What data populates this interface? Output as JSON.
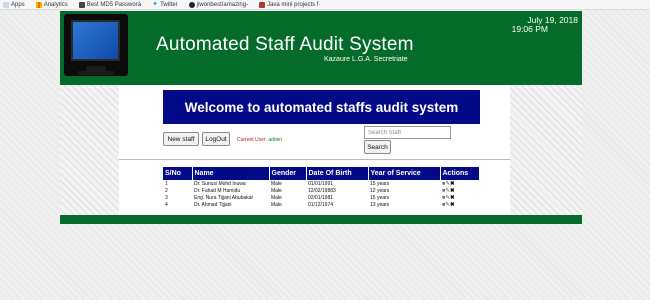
{
  "bookmarks": [
    {
      "label": "Apps",
      "icon": "apps-icon"
    },
    {
      "label": "Analytics",
      "icon": "analytics-icon"
    },
    {
      "label": "Best MD5 Passworà",
      "icon": "bookmark-icon"
    },
    {
      "label": "Twitter",
      "icon": "twitter-icon"
    },
    {
      "label": "jiwonbest/amazing-",
      "icon": "github-icon"
    },
    {
      "label": "Java mini projects f·",
      "icon": "java-icon"
    }
  ],
  "header": {
    "title": "Automated Staff Audit System",
    "subtitle": "Kazaure L.G.A. Secretriate",
    "date": "July 19, 2018",
    "time": "19:06 PM"
  },
  "banner": "Welcome to automated staffs audit system",
  "toolbar": {
    "new_staff": "New staff",
    "logout": "LogOut",
    "current_user_label": "Current User:",
    "current_user": "admin",
    "search_placeholder": "Search Staff",
    "search_button": "Search"
  },
  "table": {
    "headers": [
      "S/No",
      "Name",
      "Gender",
      "Date Of Birth",
      "Year of Service",
      "Actions"
    ],
    "rows": [
      [
        "1",
        "Dr. Sunusi Mohd Inuwa",
        "Male",
        "01/01/1991",
        "15 years"
      ],
      [
        "2",
        "Dr. Fahad M Hamidu",
        "Male",
        "12/02/19883",
        "12 years"
      ],
      [
        "3",
        "Eng. Nura Tijjani Abubakar",
        "Male",
        "02/01/1981",
        "15 years"
      ],
      [
        "4",
        "Dr. Ahmad Tijjani",
        "Male",
        "01/12/1974",
        "13 years"
      ]
    ]
  },
  "colors": {
    "header_green": "#046b2a",
    "banner_blue": "#020a87",
    "current_user_red": "#c51313",
    "current_user_green": "#0a7d1a"
  }
}
